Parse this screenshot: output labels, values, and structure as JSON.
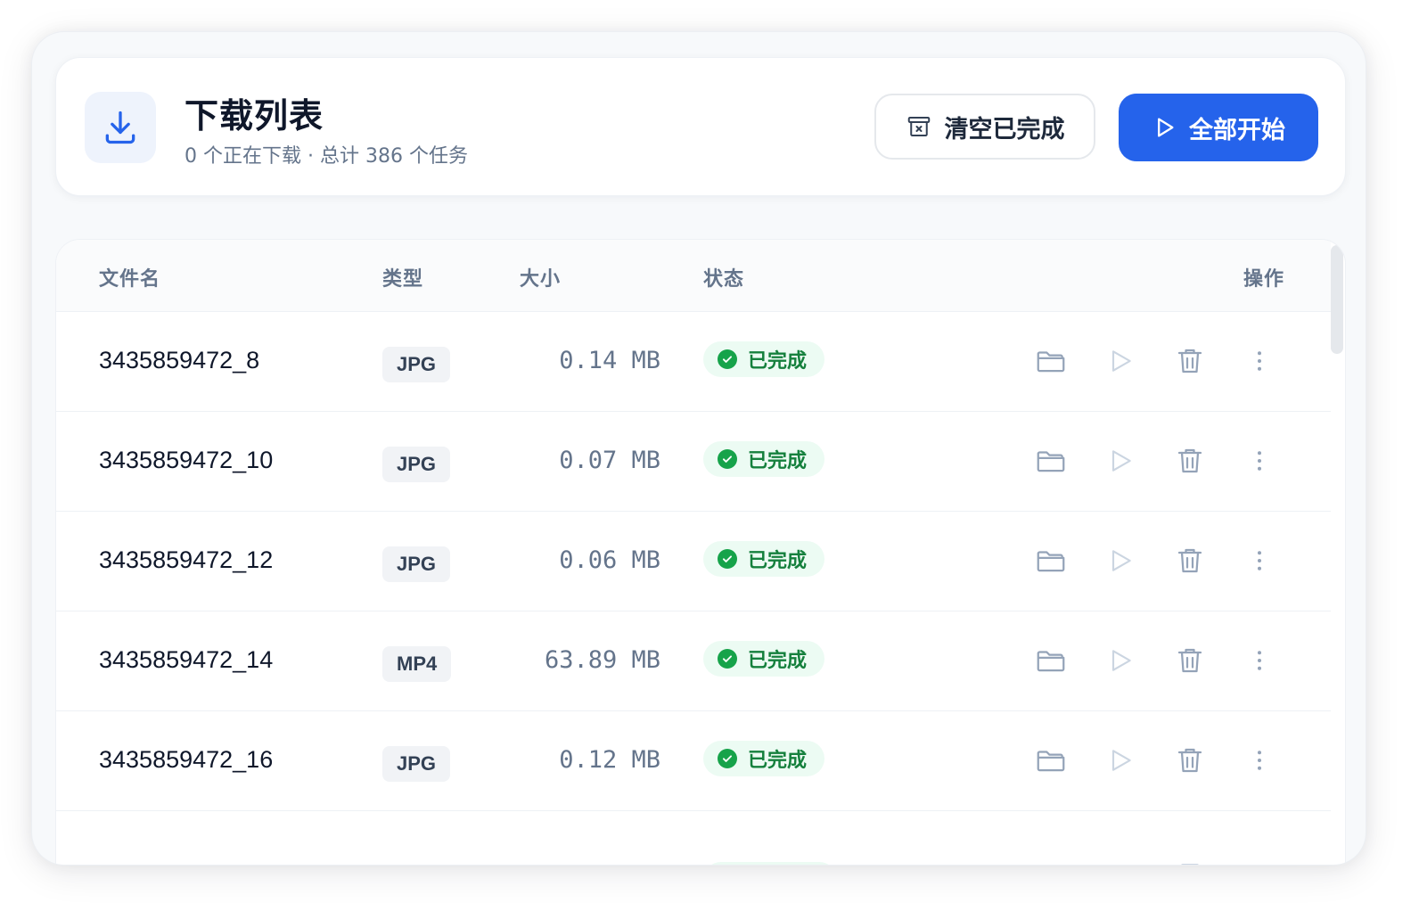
{
  "header": {
    "title": "下载列表",
    "subtitle": "0 个正在下载 · 总计 386 个任务",
    "clear_label": "清空已完成",
    "start_label": "全部开始"
  },
  "table": {
    "columns": {
      "name": "文件名",
      "type": "类型",
      "size": "大小",
      "status": "状态",
      "actions": "操作"
    },
    "rows": [
      {
        "name": "3435859472_8",
        "type": "JPG",
        "size": "0.14 MB",
        "status": "已完成"
      },
      {
        "name": "3435859472_10",
        "type": "JPG",
        "size": "0.07 MB",
        "status": "已完成"
      },
      {
        "name": "3435859472_12",
        "type": "JPG",
        "size": "0.06 MB",
        "status": "已完成"
      },
      {
        "name": "3435859472_14",
        "type": "MP4",
        "size": "63.89 MB",
        "status": "已完成"
      },
      {
        "name": "3435859472_16",
        "type": "JPG",
        "size": "0.12 MB",
        "status": "已完成"
      }
    ]
  },
  "icons": {
    "header": "download-icon",
    "clear": "archive-x-icon",
    "start": "play-icon",
    "status": "check-circle-icon",
    "open": "folder-icon",
    "play": "play-icon",
    "delete": "trash-icon",
    "more": "more-vertical-icon"
  },
  "colors": {
    "accent": "#2563eb",
    "success": "#16a34a",
    "success_bg": "#ecfbf3"
  }
}
